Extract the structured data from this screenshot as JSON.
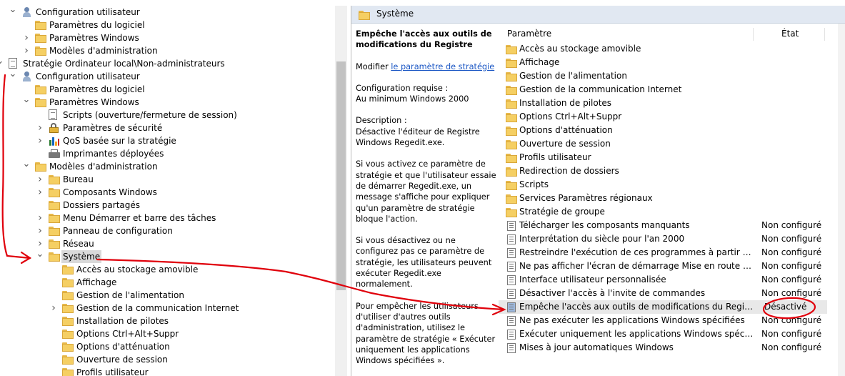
{
  "tree": {
    "items": [
      {
        "label": "Configuration utilisateur",
        "level": 1,
        "icon": "user-icon",
        "expander": "expanded",
        "selected": false
      },
      {
        "label": "Paramètres du logiciel",
        "level": 2,
        "icon": "folder-icon",
        "expander": "none",
        "selected": false
      },
      {
        "label": "Paramètres Windows",
        "level": 2,
        "icon": "folder-icon",
        "expander": "collapsed",
        "selected": false
      },
      {
        "label": "Modèles d'administration",
        "level": 2,
        "icon": "folder-icon",
        "expander": "collapsed",
        "selected": false
      },
      {
        "label": "Stratégie Ordinateur local\\Non-administrateurs",
        "level": 0,
        "icon": "document-icon",
        "expander": "expanded",
        "selected": false
      },
      {
        "label": "Configuration utilisateur",
        "level": 1,
        "icon": "user-icon",
        "expander": "expanded",
        "selected": false
      },
      {
        "label": "Paramètres du logiciel",
        "level": 2,
        "icon": "folder-icon",
        "expander": "none",
        "selected": false
      },
      {
        "label": "Paramètres Windows",
        "level": 2,
        "icon": "folder-icon",
        "expander": "expanded",
        "selected": false
      },
      {
        "label": "Scripts (ouverture/fermeture de session)",
        "level": 3,
        "icon": "document-icon",
        "expander": "none",
        "selected": false
      },
      {
        "label": "Paramètres de sécurité",
        "level": 3,
        "icon": "lock-icon",
        "expander": "collapsed",
        "selected": false
      },
      {
        "label": "QoS basée sur la stratégie",
        "level": 3,
        "icon": "chart-icon",
        "expander": "collapsed",
        "selected": false
      },
      {
        "label": "Imprimantes déployées",
        "level": 3,
        "icon": "printer-icon",
        "expander": "none",
        "selected": false
      },
      {
        "label": "Modèles d'administration",
        "level": 2,
        "icon": "folder-icon",
        "expander": "expanded",
        "selected": false
      },
      {
        "label": "Bureau",
        "level": 3,
        "icon": "folder-icon",
        "expander": "collapsed",
        "selected": false
      },
      {
        "label": "Composants Windows",
        "level": 3,
        "icon": "folder-icon",
        "expander": "collapsed",
        "selected": false
      },
      {
        "label": "Dossiers partagés",
        "level": 3,
        "icon": "folder-icon",
        "expander": "none",
        "selected": false
      },
      {
        "label": "Menu Démarrer et barre des tâches",
        "level": 3,
        "icon": "folder-icon",
        "expander": "collapsed",
        "selected": false
      },
      {
        "label": "Panneau de configuration",
        "level": 3,
        "icon": "folder-icon",
        "expander": "collapsed",
        "selected": false
      },
      {
        "label": "Réseau",
        "level": 3,
        "icon": "folder-icon",
        "expander": "collapsed",
        "selected": false
      },
      {
        "label": "Système",
        "level": 3,
        "icon": "folder-icon",
        "expander": "expanded",
        "selected": true
      },
      {
        "label": "Accès au stockage amovible",
        "level": 4,
        "icon": "folder-icon",
        "expander": "none",
        "selected": false
      },
      {
        "label": "Affichage",
        "level": 4,
        "icon": "folder-icon",
        "expander": "none",
        "selected": false
      },
      {
        "label": "Gestion de l'alimentation",
        "level": 4,
        "icon": "folder-icon",
        "expander": "none",
        "selected": false
      },
      {
        "label": "Gestion de la communication Internet",
        "level": 4,
        "icon": "folder-icon",
        "expander": "collapsed",
        "selected": false
      },
      {
        "label": "Installation de pilotes",
        "level": 4,
        "icon": "folder-icon",
        "expander": "none",
        "selected": false
      },
      {
        "label": "Options Ctrl+Alt+Suppr",
        "level": 4,
        "icon": "folder-icon",
        "expander": "none",
        "selected": false
      },
      {
        "label": "Options d'atténuation",
        "level": 4,
        "icon": "folder-icon",
        "expander": "none",
        "selected": false
      },
      {
        "label": "Ouverture de session",
        "level": 4,
        "icon": "folder-icon",
        "expander": "none",
        "selected": false
      },
      {
        "label": "Profils utilisateur",
        "level": 4,
        "icon": "folder-icon",
        "expander": "none",
        "selected": false
      }
    ],
    "scroll_fraction": 0.37
  },
  "details": {
    "header_title": "Système",
    "desc_title": "Empêche l'accès aux outils de modifications du Registre",
    "modify_prefix": "Modifier ",
    "modify_link": "le paramètre de stratégie",
    "requirement_label": "Configuration requise :",
    "requirement_value": "Au minimum Windows 2000",
    "description_label": "Description :",
    "description_text": "Désactive l'éditeur de Registre Windows Regedit.exe.",
    "para1": "Si vous activez ce paramètre de stratégie et que l'utilisateur essaie de démarrer Regedit.exe, un message s'affiche pour expliquer qu'un paramètre de stratégie bloque l'action.",
    "para2": "Si vous désactivez ou ne configurez pas ce paramètre de stratégie, les utilisateurs peuvent exécuter Regedit.exe normalement.",
    "para3": "Pour empêcher les utilisateurs d'utiliser d'autres outils d'administration, utilisez le paramètre de stratégie « Exécuter uniquement les applications Windows spécifiées »."
  },
  "list": {
    "col_param": "Paramètre",
    "col_state": "État",
    "rows": [
      {
        "name": "Accès au stockage amovible",
        "state": "",
        "icon": "folder-icon"
      },
      {
        "name": "Affichage",
        "state": "",
        "icon": "folder-icon"
      },
      {
        "name": "Gestion de l'alimentation",
        "state": "",
        "icon": "folder-icon"
      },
      {
        "name": "Gestion de la communication Internet",
        "state": "",
        "icon": "folder-icon"
      },
      {
        "name": "Installation de pilotes",
        "state": "",
        "icon": "folder-icon"
      },
      {
        "name": "Options Ctrl+Alt+Suppr",
        "state": "",
        "icon": "folder-icon"
      },
      {
        "name": "Options d'atténuation",
        "state": "",
        "icon": "folder-icon"
      },
      {
        "name": "Ouverture de session",
        "state": "",
        "icon": "folder-icon"
      },
      {
        "name": "Profils utilisateur",
        "state": "",
        "icon": "folder-icon"
      },
      {
        "name": "Redirection de dossiers",
        "state": "",
        "icon": "folder-icon"
      },
      {
        "name": "Scripts",
        "state": "",
        "icon": "folder-icon"
      },
      {
        "name": "Services Paramètres régionaux",
        "state": "",
        "icon": "folder-icon"
      },
      {
        "name": "Stratégie de groupe",
        "state": "",
        "icon": "folder-icon"
      },
      {
        "name": "Télécharger les composants manquants",
        "state": "Non configuré",
        "icon": "setting-icon"
      },
      {
        "name": "Interprétation du siècle pour l'an 2000",
        "state": "Non configuré",
        "icon": "setting-icon"
      },
      {
        "name": "Restreindre l'exécution de ces programmes à partir de l'aide",
        "state": "Non configuré",
        "icon": "setting-icon"
      },
      {
        "name": "Ne pas afficher l'écran de démarrage Mise en route à l'ouverture de session",
        "state": "Non configuré",
        "icon": "setting-icon"
      },
      {
        "name": "Interface utilisateur personnalisée",
        "state": "Non configuré",
        "icon": "setting-icon"
      },
      {
        "name": "Désactiver l'accès à l'invite de commandes",
        "state": "Non configuré",
        "icon": "setting-icon"
      },
      {
        "name": "Empêche l'accès aux outils de modifications du Registre",
        "state": "Désactivé",
        "icon": "setting-icon",
        "highlight": true
      },
      {
        "name": "Ne pas exécuter les applications Windows spécifiées",
        "state": "Non configuré",
        "icon": "setting-icon"
      },
      {
        "name": "Exécuter uniquement les applications Windows spécifiées",
        "state": "Non configuré",
        "icon": "setting-icon"
      },
      {
        "name": "Mises à jour automatiques Windows",
        "state": "Non configuré",
        "icon": "setting-icon"
      }
    ]
  },
  "colors": {
    "annotation": "#e0000b",
    "header_bg": "#e1e8f2",
    "selection": "#d9d9d9",
    "link": "#1a56c4"
  }
}
